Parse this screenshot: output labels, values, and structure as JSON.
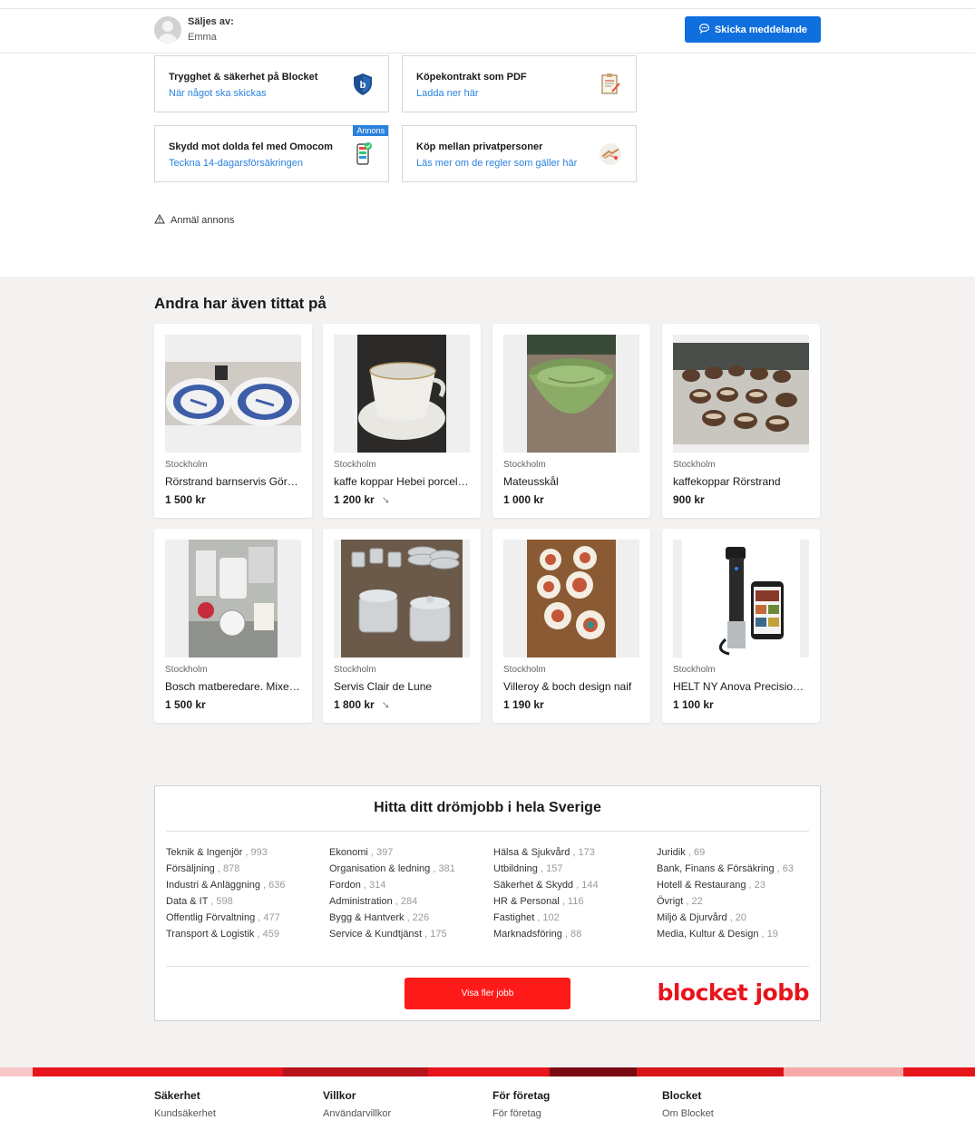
{
  "seller": {
    "label": "Säljes av:",
    "name": "Emma",
    "message_button": "Skicka meddelande"
  },
  "info_cards": [
    {
      "title": "Trygghet & säkerhet på Blocket",
      "link": "När något ska skickas",
      "icon": "shield-icon"
    },
    {
      "title": "Köpekontrakt som PDF",
      "link": "Ladda ner här",
      "icon": "contract-icon"
    },
    {
      "title": "Skydd mot dolda fel med Omocom",
      "link": "Teckna 14-dagarsförsäkringen",
      "icon": "phone-check-icon",
      "tag": "Annons"
    },
    {
      "title": "Köp mellan privatpersoner",
      "link": "Läs mer om de regler som gäller här",
      "icon": "handshake-icon"
    }
  ],
  "report": {
    "label": "Anmäl annons"
  },
  "recommendations": {
    "title": "Andra har även tittat på",
    "items": [
      {
        "location": "Stockholm",
        "title": "Rörstrand barnservis Görel Ågren",
        "price": "1 500 kr",
        "reduced": false
      },
      {
        "location": "Stockholm",
        "title": "kaffe koppar Hebei porcelain",
        "price": "1 200 kr",
        "reduced": true
      },
      {
        "location": "Stockholm",
        "title": "Mateusskål",
        "price": "1 000 kr",
        "reduced": false
      },
      {
        "location": "Stockholm",
        "title": "kaffekoppar Rörstrand",
        "price": "900 kr",
        "reduced": false
      },
      {
        "location": "Stockholm",
        "title": "Bosch matberedare. Mixer med tillbehör",
        "price": "1 500 kr",
        "reduced": false
      },
      {
        "location": "Stockholm",
        "title": "Servis Clair de Lune",
        "price": "1 800 kr",
        "reduced": true
      },
      {
        "location": "Stockholm",
        "title": "Villeroy & boch design naif",
        "price": "1 190 kr",
        "reduced": false
      },
      {
        "location": "Stockholm",
        "title": "HELT NY Anova Precision Cooker",
        "price": "1 100 kr",
        "reduced": false
      }
    ]
  },
  "jobs": {
    "title": "Hitta ditt drömjobb i hela Sverige",
    "columns": [
      [
        {
          "name": "Teknik & Ingenjör",
          "count": " , 993"
        },
        {
          "name": "Försäljning",
          "count": " , 878"
        },
        {
          "name": "Industri & Anläggning",
          "count": " , 636"
        },
        {
          "name": "Data & IT",
          "count": " , 598"
        },
        {
          "name": "Offentlig Förvaltning",
          "count": " , 477"
        },
        {
          "name": "Transport & Logistik",
          "count": " , 459"
        }
      ],
      [
        {
          "name": "Ekonomi",
          "count": " , 397"
        },
        {
          "name": "Organisation & ledning",
          "count": " , 381"
        },
        {
          "name": "Fordon",
          "count": " , 314"
        },
        {
          "name": "Administration",
          "count": " , 284"
        },
        {
          "name": "Bygg & Hantverk",
          "count": " , 226"
        },
        {
          "name": "Service & Kundtjänst",
          "count": " , 175"
        }
      ],
      [
        {
          "name": "Hälsa & Sjukvård",
          "count": " , 173"
        },
        {
          "name": "Utbildning",
          "count": " , 157"
        },
        {
          "name": "Säkerhet & Skydd",
          "count": " , 144"
        },
        {
          "name": "HR & Personal",
          "count": " , 116"
        },
        {
          "name": "Fastighet",
          "count": " , 102"
        },
        {
          "name": "Marknadsföring",
          "count": " , 88"
        }
      ],
      [
        {
          "name": "Juridik",
          "count": " , 69"
        },
        {
          "name": "Bank, Finans & Försäkring",
          "count": " , 63"
        },
        {
          "name": "Hotell & Restaurang",
          "count": " , 23"
        },
        {
          "name": "Övrigt",
          "count": " , 22"
        },
        {
          "name": "Miljö & Djurvård",
          "count": " , 20"
        },
        {
          "name": "Media, Kultur & Design",
          "count": " , 19"
        }
      ]
    ],
    "more_button": "Visa fler jobb",
    "logo_text": "blocket jobb"
  },
  "footer": {
    "columns": [
      {
        "heading": "Säkerhet",
        "link": "Kundsäkerhet"
      },
      {
        "heading": "Villkor",
        "link": "Användarvillkor"
      },
      {
        "heading": "För företag",
        "link": "För företag"
      },
      {
        "heading": "Blocket",
        "link": "Om Blocket"
      }
    ]
  },
  "colors": {
    "accent_blue": "#0f6fde",
    "link_blue": "#2a82de",
    "blocket_red": "#e8141b",
    "button_red": "#ff1a1a",
    "section_bg": "#f3f2f0"
  }
}
